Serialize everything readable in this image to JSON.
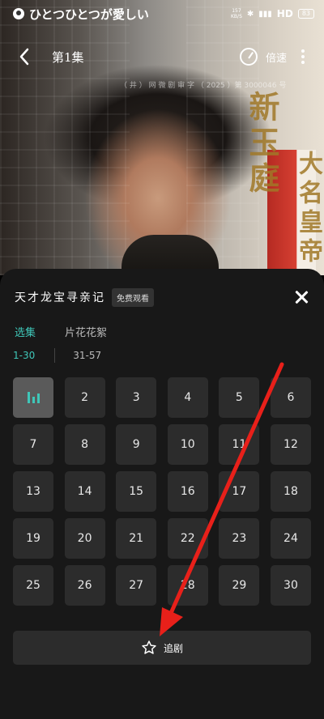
{
  "status_bar": {
    "notification_text": "ひとつひとつが愛しい",
    "net_speed": "157\nKB/S",
    "network_label": "HD",
    "battery": "83"
  },
  "player": {
    "episode_title": "第1集",
    "speed_label": "倍速",
    "license_text": "（ 井 ） 网 微 剧 审 字 （ 2025 ）第 3000046 号",
    "calligraphy_left": "新玉庭",
    "calligraphy_right": "大名皇帝"
  },
  "sheet": {
    "drama_title": "天才龙宝寻亲记",
    "free_badge": "免费观看",
    "tabs": [
      "选集",
      "片花花絮"
    ],
    "ranges": [
      "1-30",
      "31-57"
    ],
    "current_episode": 1,
    "episodes": [
      "1",
      "2",
      "3",
      "4",
      "5",
      "6",
      "7",
      "8",
      "9",
      "10",
      "11",
      "12",
      "13",
      "14",
      "15",
      "16",
      "17",
      "18",
      "19",
      "20",
      "21",
      "22",
      "23",
      "24",
      "25",
      "26",
      "27",
      "28",
      "29",
      "30"
    ],
    "follow_label": "追剧"
  },
  "colors": {
    "accent": "#3fc6b8",
    "sheet_bg": "#181818",
    "cell_bg": "#2c2c2c",
    "annotation": "#e8201a"
  }
}
